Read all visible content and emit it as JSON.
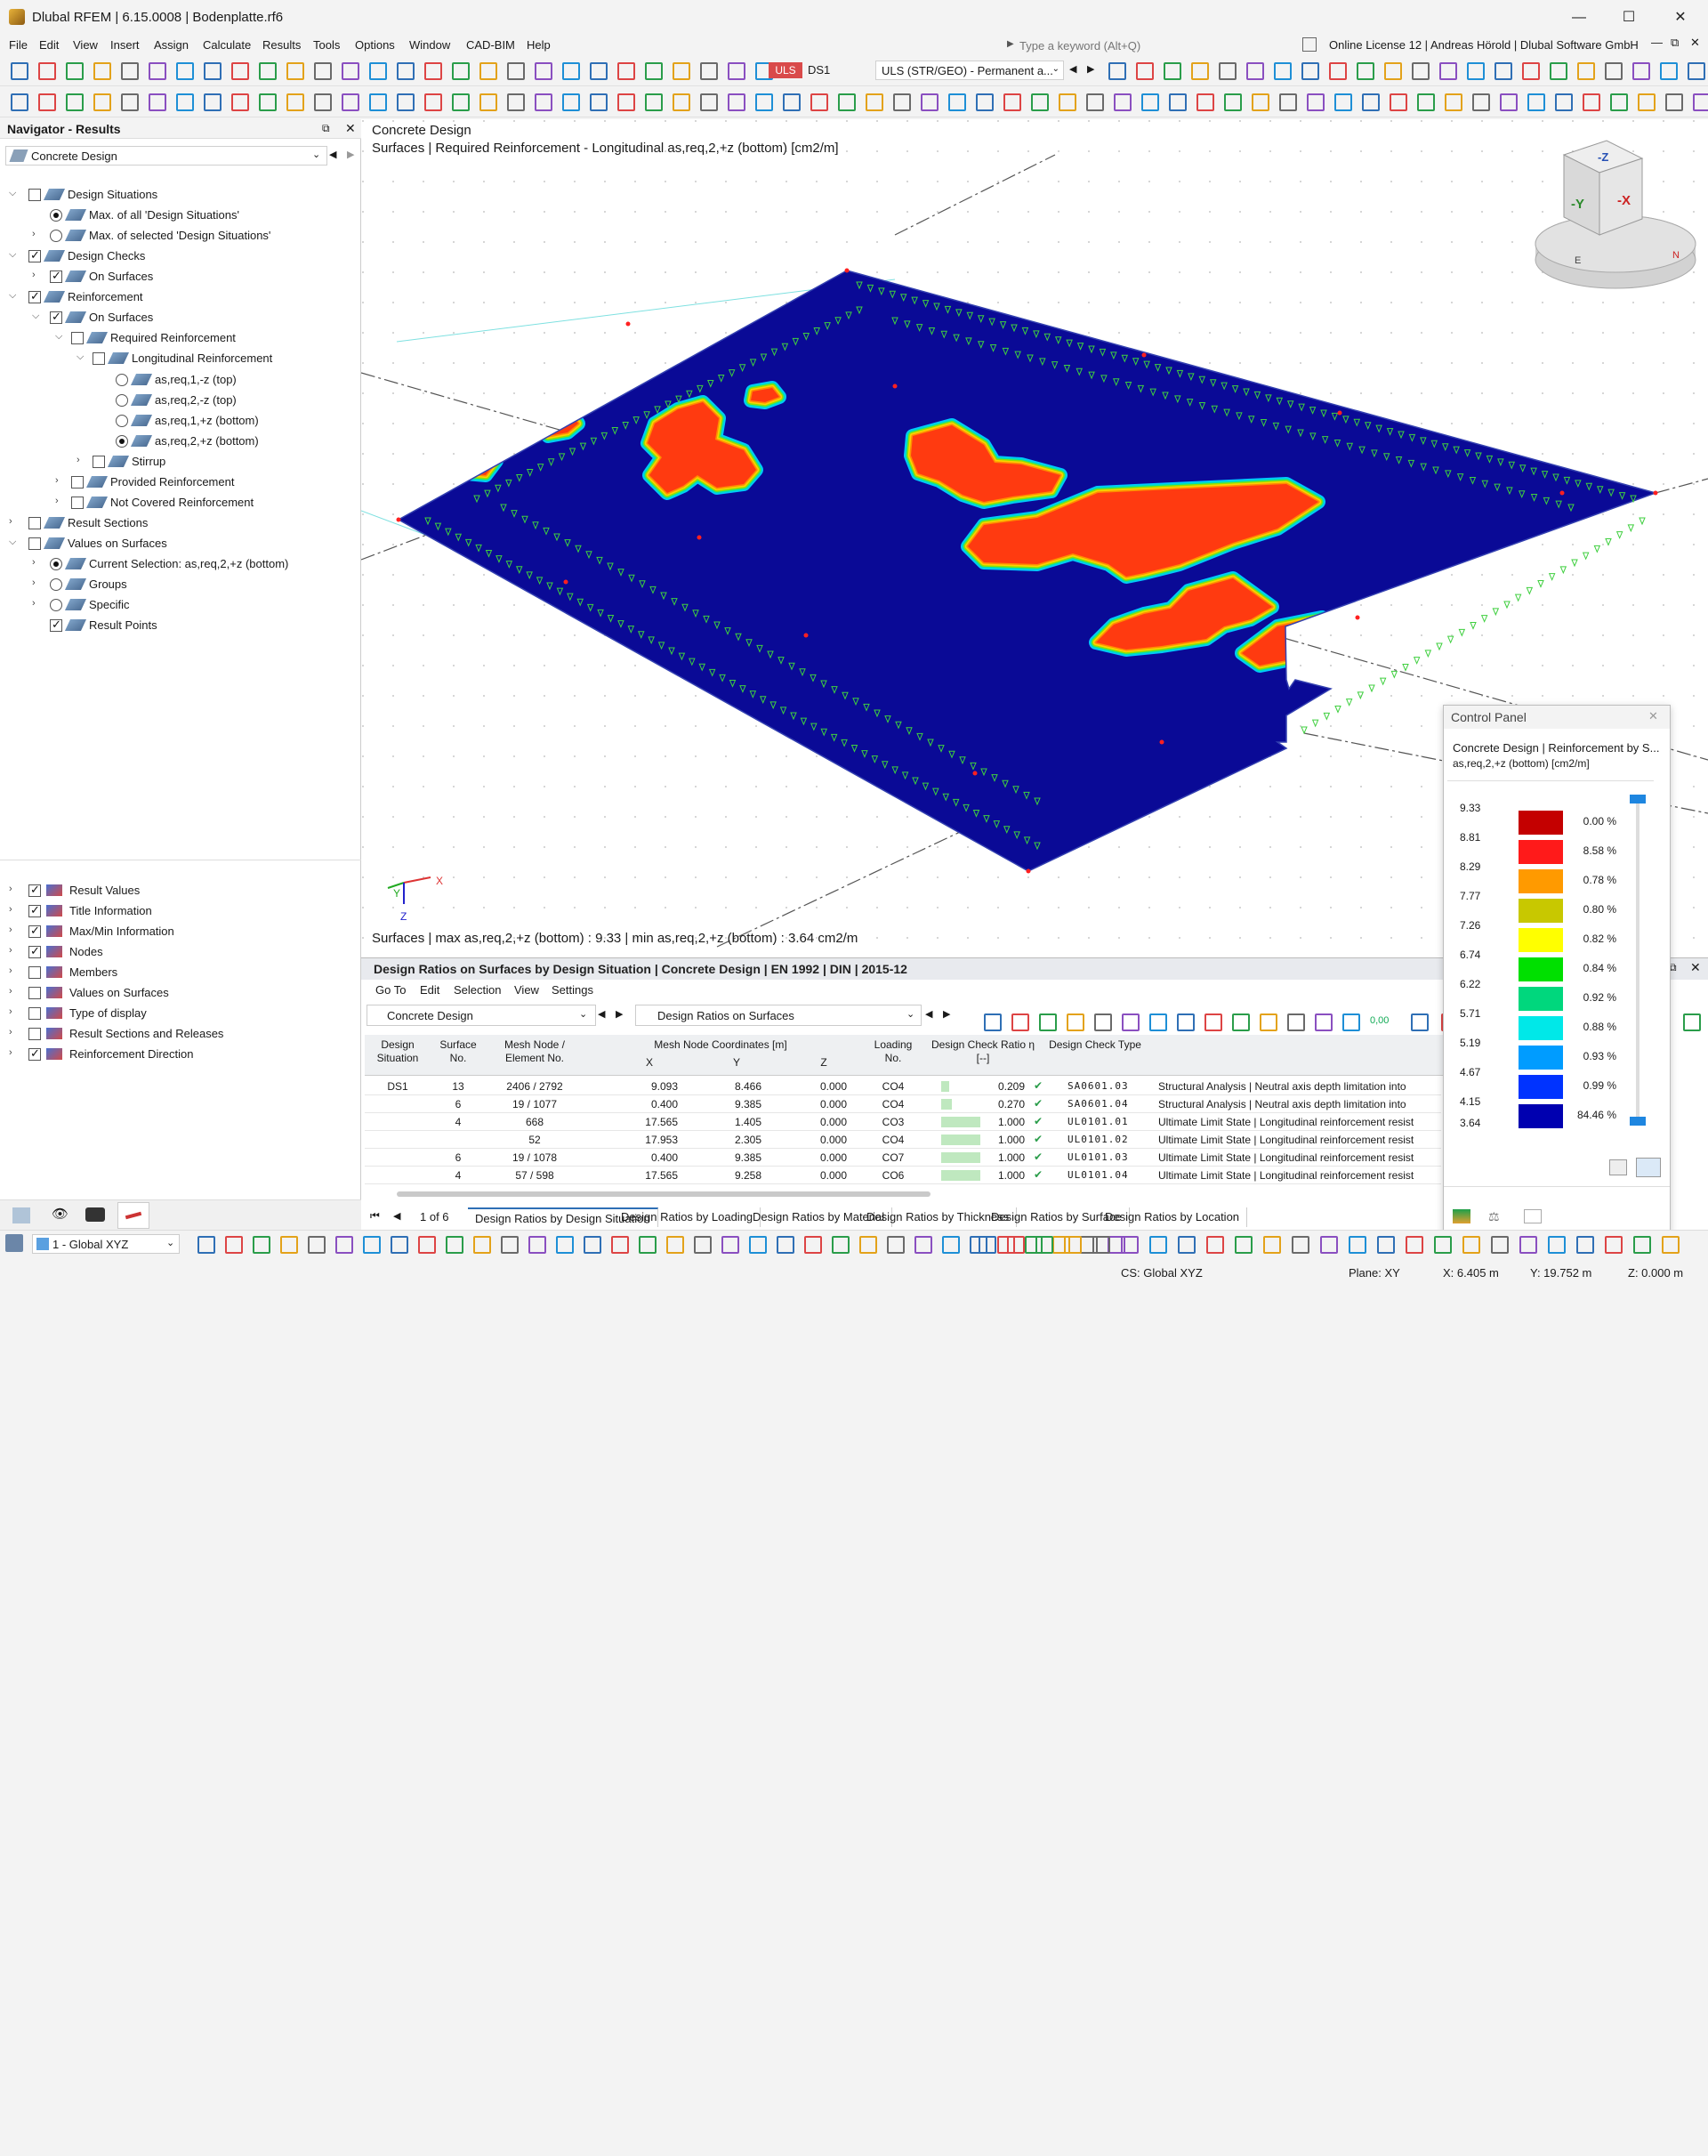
{
  "window": {
    "title": "Dlubal RFEM | 6.15.0008 | Bodenplatte.rf6",
    "min": "—",
    "max": "☐",
    "close": "✕"
  },
  "menu": [
    "File",
    "Edit",
    "View",
    "Insert",
    "Assign",
    "Calculate",
    "Results",
    "Tools",
    "Options",
    "Window",
    "CAD-BIM",
    "Help"
  ],
  "search": {
    "placeholder": "Type a keyword (Alt+Q)"
  },
  "license": "Online License 12 | Andreas Hörold | Dlubal Software GmbH",
  "toolbar": {
    "uls": "ULS",
    "ds": "DS1",
    "combo": "ULS (STR/GEO) - Permanent a..."
  },
  "navigator": {
    "title": "Navigator - Results",
    "selector": "Concrete Design",
    "tree": [
      {
        "label": "Design Situations",
        "indent": 0,
        "ctrl": "cb",
        "on": false,
        "exp": "v"
      },
      {
        "label": "Max. of all 'Design Situations'",
        "indent": 2,
        "ctrl": "rb",
        "on": true,
        "exp": ""
      },
      {
        "label": "Max. of selected 'Design Situations'",
        "indent": 2,
        "ctrl": "rb",
        "on": false,
        "exp": ">"
      },
      {
        "label": "Design Checks",
        "indent": 0,
        "ctrl": "cb",
        "on": true,
        "exp": "v"
      },
      {
        "label": "On Surfaces",
        "indent": 2,
        "ctrl": "cb",
        "on": true,
        "exp": ">"
      },
      {
        "label": "Reinforcement",
        "indent": 0,
        "ctrl": "cb",
        "on": true,
        "exp": "v"
      },
      {
        "label": "On Surfaces",
        "indent": 2,
        "ctrl": "cb",
        "on": true,
        "exp": "v"
      },
      {
        "label": "Required Reinforcement",
        "indent": 3,
        "ctrl": "cb",
        "on": false,
        "exp": "v"
      },
      {
        "label": "Longitudinal Reinforcement",
        "indent": 4,
        "ctrl": "cb",
        "on": false,
        "exp": "v"
      },
      {
        "label": "as,req,1,-z (top)",
        "indent": 5,
        "ctrl": "rb",
        "on": false,
        "exp": ""
      },
      {
        "label": "as,req,2,-z (top)",
        "indent": 5,
        "ctrl": "rb",
        "on": false,
        "exp": ""
      },
      {
        "label": "as,req,1,+z (bottom)",
        "indent": 5,
        "ctrl": "rb",
        "on": false,
        "exp": ""
      },
      {
        "label": "as,req,2,+z (bottom)",
        "indent": 5,
        "ctrl": "rb",
        "on": true,
        "exp": ""
      },
      {
        "label": "Stirrup",
        "indent": 4,
        "ctrl": "cb",
        "on": false,
        "exp": ">"
      },
      {
        "label": "Provided Reinforcement",
        "indent": 3,
        "ctrl": "cb",
        "on": false,
        "exp": ">"
      },
      {
        "label": "Not Covered Reinforcement",
        "indent": 3,
        "ctrl": "cb",
        "on": false,
        "exp": ">"
      },
      {
        "label": "Result Sections",
        "indent": 0,
        "ctrl": "cb",
        "on": false,
        "exp": ">"
      },
      {
        "label": "Values on Surfaces",
        "indent": 0,
        "ctrl": "cb",
        "on": false,
        "exp": "v"
      },
      {
        "label": "Current Selection: as,req,2,+z (bottom)",
        "indent": 2,
        "ctrl": "rb",
        "on": true,
        "exp": ">"
      },
      {
        "label": "Groups",
        "indent": 2,
        "ctrl": "rb",
        "on": false,
        "exp": ">"
      },
      {
        "label": "Specific",
        "indent": 2,
        "ctrl": "rb",
        "on": false,
        "exp": ">"
      },
      {
        "label": "Result Points",
        "indent": 2,
        "ctrl": "cb",
        "on": true,
        "exp": ""
      }
    ],
    "display": [
      {
        "label": "Result Values",
        "on": true
      },
      {
        "label": "Title Information",
        "on": true
      },
      {
        "label": "Max/Min Information",
        "on": true
      },
      {
        "label": "Nodes",
        "on": true
      },
      {
        "label": "Members",
        "on": false
      },
      {
        "label": "Values on Surfaces",
        "on": false
      },
      {
        "label": "Type of display",
        "on": false
      },
      {
        "label": "Result Sections and Releases",
        "on": false
      },
      {
        "label": "Reinforcement Direction",
        "on": true
      }
    ]
  },
  "viewport": {
    "heading": "Concrete Design",
    "subtitle": "Surfaces | Required Reinforcement - Longitudinal as,req,2,+z (bottom) [cm2/m]",
    "footer": "Surfaces | max as,req,2,+z (bottom) : 9.33 | min as,req,2,+z (bottom) : 3.64 cm2/m",
    "cube": {
      "top": "-Z",
      "front": "-Y",
      "right": "-X",
      "e": "E",
      "n": "N"
    },
    "axes": {
      "x": "X",
      "y": "Y",
      "z": "Z"
    }
  },
  "control_panel": {
    "title": "Control Panel",
    "heading": "Concrete Design | Reinforcement by S...",
    "unit": "as,req,2,+z (bottom) [cm2/m]",
    "legend": [
      {
        "value": "9.33",
        "color": "#c40000",
        "pct": "0.00 %"
      },
      {
        "value": "8.81",
        "color": "#ff1a1a",
        "pct": "8.58 %"
      },
      {
        "value": "8.29",
        "color": "#ff9a00",
        "pct": "0.78 %"
      },
      {
        "value": "7.77",
        "color": "#c8c800",
        "pct": "0.80 %"
      },
      {
        "value": "7.26",
        "color": "#ffff00",
        "pct": "0.82 %"
      },
      {
        "value": "6.74",
        "color": "#00e000",
        "pct": "0.84 %"
      },
      {
        "value": "6.22",
        "color": "#00d77d",
        "pct": "0.92 %"
      },
      {
        "value": "5.71",
        "color": "#00e8e8",
        "pct": "0.88 %"
      },
      {
        "value": "5.19",
        "color": "#009cff",
        "pct": "0.93 %"
      },
      {
        "value": "4.67",
        "color": "#0033ff",
        "pct": "0.99 %"
      },
      {
        "value": "4.15",
        "color": "#0000b0",
        "pct": "84.46 %"
      }
    ],
    "min_value": "3.64"
  },
  "bottom": {
    "title": "Design Ratios on Surfaces by Design Situation | Concrete Design | EN 1992 | DIN | 2015-12",
    "menu": [
      "Go To",
      "Edit",
      "Selection",
      "View",
      "Settings"
    ],
    "module": "Concrete Design",
    "result": "Design Ratios on Surfaces",
    "headers": {
      "ds": "Design Situation",
      "surf": "Surface No.",
      "mesh": "Mesh Node / Element No.",
      "coords": "Mesh Node Coordinates [m]",
      "x": "X",
      "y": "Y",
      "z": "Z",
      "load": "Loading No.",
      "ratio": "Design Check Ratio η [--]",
      "type": "Design Check Type"
    },
    "rows": [
      {
        "ds": "DS1",
        "surf": "13",
        "mesh": "2406 / 2792",
        "x": "9.093",
        "y": "8.466",
        "z": "0.000",
        "load": "CO4",
        "ratio": "0.209",
        "fill": 0.209,
        "type": "SA0601.03",
        "desc": "Structural Analysis | Neutral axis depth limitation into"
      },
      {
        "ds": "",
        "surf": "6",
        "mesh": "19 / 1077",
        "x": "0.400",
        "y": "9.385",
        "z": "0.000",
        "load": "CO4",
        "ratio": "0.270",
        "fill": 0.27,
        "type": "SA0601.04",
        "desc": "Structural Analysis | Neutral axis depth limitation into"
      },
      {
        "ds": "",
        "surf": "4",
        "mesh": "668",
        "x": "17.565",
        "y": "1.405",
        "z": "0.000",
        "load": "CO3",
        "ratio": "1.000",
        "fill": 1,
        "type": "UL0101.01",
        "desc": "Ultimate Limit State | Longitudinal reinforcement resist"
      },
      {
        "ds": "",
        "surf": "",
        "mesh": "52",
        "x": "17.953",
        "y": "2.305",
        "z": "0.000",
        "load": "CO4",
        "ratio": "1.000",
        "fill": 1,
        "type": "UL0101.02",
        "desc": "Ultimate Limit State | Longitudinal reinforcement resist"
      },
      {
        "ds": "",
        "surf": "6",
        "mesh": "19 / 1078",
        "x": "0.400",
        "y": "9.385",
        "z": "0.000",
        "load": "CO7",
        "ratio": "1.000",
        "fill": 1,
        "type": "UL0101.03",
        "desc": "Ultimate Limit State | Longitudinal reinforcement resist"
      },
      {
        "ds": "",
        "surf": "4",
        "mesh": "57 / 598",
        "x": "17.565",
        "y": "9.258",
        "z": "0.000",
        "load": "CO6",
        "ratio": "1.000",
        "fill": 1,
        "type": "UL0101.04",
        "desc": "Ultimate Limit State | Longitudinal reinforcement resist"
      }
    ],
    "pager": "1 of 6",
    "tabs": [
      "Design Ratios by Design Situation",
      "Design Ratios by Loading",
      "Design Ratios by Material",
      "Design Ratios by Thickness",
      "Design Ratios by Surface",
      "Design Ratios by Location"
    ],
    "ratio_preset": "0,00"
  },
  "status": {
    "cs_combo": "1 - Global XYZ",
    "cs": "CS: Global XYZ",
    "plane": "Plane: XY",
    "x": "X: 6.405 m",
    "y": "Y: 19.752 m",
    "z": "Z: 0.000 m"
  }
}
